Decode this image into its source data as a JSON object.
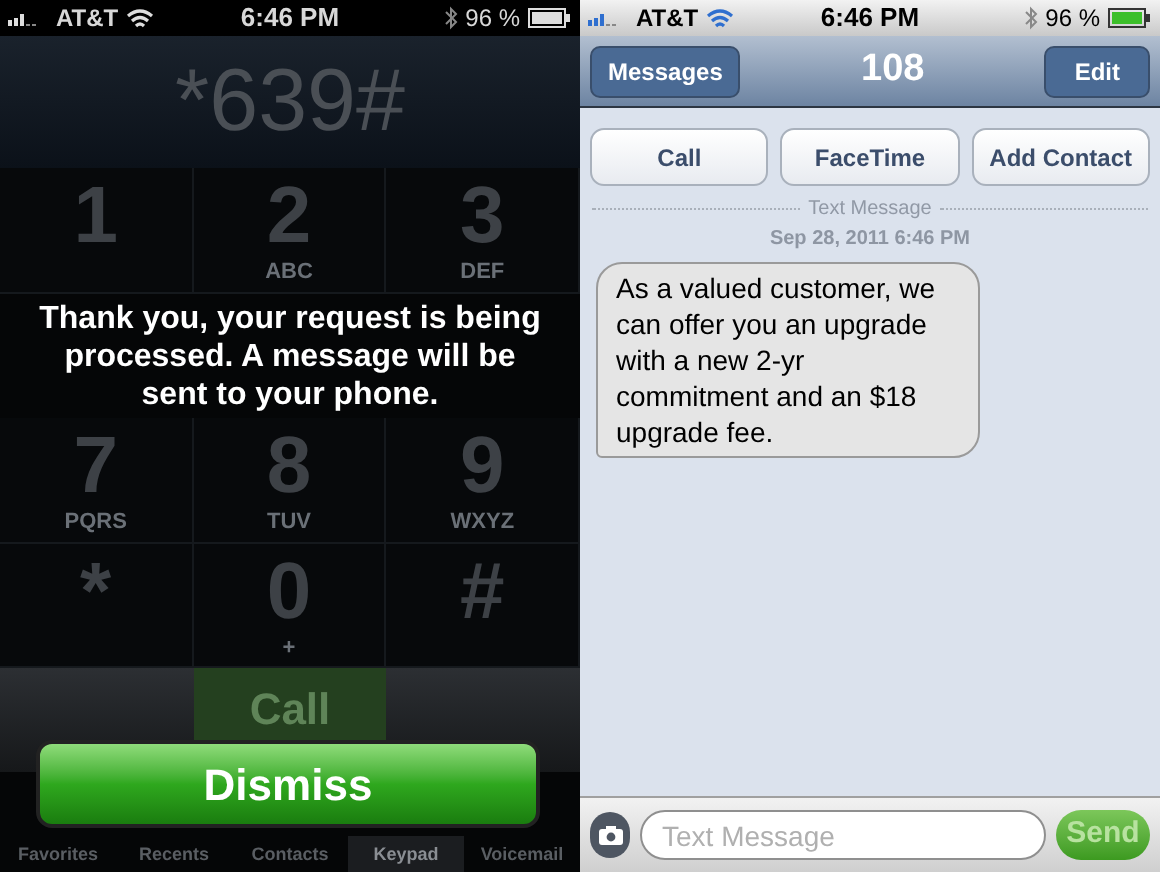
{
  "dialer": {
    "status_bar": {
      "carrier": "AT&T",
      "time": "6:46 PM",
      "battery": "96 %"
    },
    "dialed_number": "*639#",
    "keys": [
      {
        "kind": "key",
        "digit": "1"
      },
      {
        "kind": "key",
        "digit": "2",
        "letters": "ABC"
      },
      {
        "kind": "key",
        "digit": "3",
        "letters": "DEF"
      },
      {
        "kind": "key",
        "digit": "7",
        "letters": "PQRS"
      },
      {
        "kind": "key",
        "digit": "8",
        "letters": "TUV"
      },
      {
        "kind": "key",
        "digit": "9",
        "letters": "WXYZ"
      },
      {
        "kind": "key",
        "digit": "*"
      },
      {
        "kind": "key",
        "digit": "0",
        "letters": "+"
      },
      {
        "kind": "key",
        "digit": "#"
      }
    ],
    "call_button": "Call",
    "tabs": [
      {
        "label": "Favorites",
        "selected": false
      },
      {
        "label": "Recents",
        "selected": false
      },
      {
        "label": "Contacts",
        "selected": false
      },
      {
        "label": "Keypad",
        "selected": true
      },
      {
        "label": "Voicemail",
        "selected": false
      }
    ],
    "alert": {
      "message": "Thank you, your request is being processed. A message will be sent to your phone.",
      "button": "Dismiss"
    }
  },
  "messages": {
    "status_bar": {
      "carrier": "AT&T",
      "time": "6:46 PM",
      "battery": "96 %"
    },
    "back_button": "Messages",
    "title": "108",
    "edit_button": "Edit",
    "actions": [
      "Call",
      "FaceTime",
      "Add Contact"
    ],
    "separator": "Text Message",
    "timestamp": "Sep 28, 2011 6:46 PM",
    "bubbles": [
      {
        "text": "As a valued customer, we can offer you an upgrade with a new 2-yr commitment and an $18 upgrade fee.",
        "incoming": true
      }
    ],
    "composer": {
      "placeholder": "Text Message",
      "send": "Send"
    }
  }
}
